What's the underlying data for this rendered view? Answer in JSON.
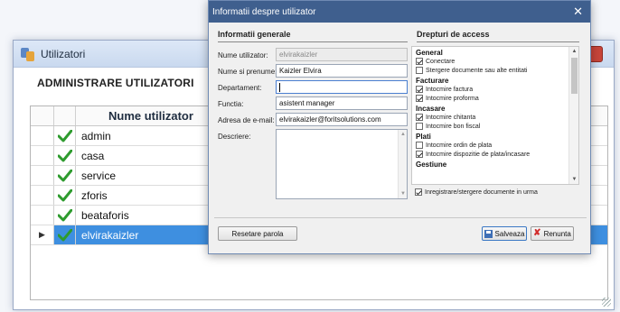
{
  "back_window": {
    "title": "Utilizatori",
    "close": "x",
    "heading": "ADMINISTRARE UTILIZATORI",
    "grid": {
      "header": "Nume utilizator",
      "rows": [
        "admin",
        "casa",
        "service",
        "zforis",
        "beataforis",
        "elvirakaizler"
      ],
      "selected_index": 5,
      "row_indicator": "▶"
    }
  },
  "dialog": {
    "title": "Informatii despre utilizator",
    "close": "✕",
    "general_section": "Informatii generale",
    "rights_section": "Drepturi de access",
    "fields": {
      "username_label": "Nume utilizator:",
      "username_value": "elvirakaizler",
      "fullname_label": "Nume si prenume:",
      "fullname_value": "Kaizler Elvira",
      "department_label": "Departament:",
      "department_value": "",
      "function_label": "Functia:",
      "function_value": "asistent manager",
      "email_label": "Adresa de e-mail:",
      "email_value": "elvirakaizler@foritsolutions.com",
      "description_label": "Descriere:"
    },
    "rights": [
      {
        "group": "General",
        "items": [
          {
            "label": "Conectare",
            "checked": true
          },
          {
            "label": "Stergere documente sau alte entitati",
            "checked": false
          }
        ]
      },
      {
        "group": "Facturare",
        "items": [
          {
            "label": "Intocmire factura",
            "checked": true
          },
          {
            "label": "Intocmire proforma",
            "checked": true
          }
        ]
      },
      {
        "group": "Incasare",
        "items": [
          {
            "label": "Intocmire chitanta",
            "checked": true
          },
          {
            "label": "Intocmire bon fiscal",
            "checked": false
          }
        ]
      },
      {
        "group": "Plati",
        "items": [
          {
            "label": "Intocmire ordin de plata",
            "checked": false
          },
          {
            "label": "Intocmire dispozitie de plata/incasare",
            "checked": true
          }
        ]
      },
      {
        "group": "Gestiune",
        "items": []
      }
    ],
    "bottom_checkbox": {
      "label": "Inregistrare/stergere documente in urma",
      "checked": true
    },
    "buttons": {
      "reset": "Resetare parola",
      "save": "Salveaza",
      "cancel": "Renunta"
    }
  },
  "colors": {
    "selection": "#3e8fe0",
    "dialog_title": "#3f5f8e",
    "check_green": "#2e9b2e",
    "close_red": "#c8453a"
  }
}
